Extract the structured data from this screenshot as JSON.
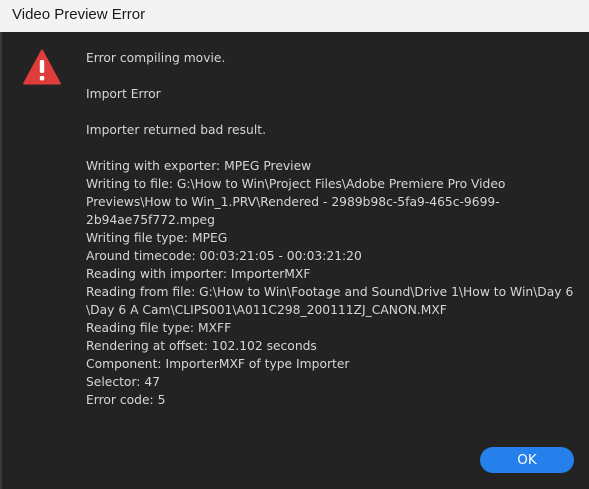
{
  "window": {
    "title": "Video Preview Error"
  },
  "icon": {
    "name": "warning-icon",
    "color": "#e03c3c"
  },
  "messages": {
    "primary": "Error compiling movie.",
    "secondary": "Import Error",
    "tertiary": "Importer returned bad result.",
    "details": [
      "Writing with exporter: MPEG Preview",
      "Writing to file: G:\\How to Win\\Project Files\\Adobe Premiere Pro Video",
      "Previews\\How to Win_1.PRV\\Rendered - 2989b98c-5fa9-465c-9699-",
      "2b94ae75f772.mpeg",
      "Writing file type: MPEG",
      "Around timecode: 00:03:21:05 - 00:03:21:20",
      "Reading with importer: ImporterMXF",
      "Reading from file: G:\\How to Win\\Footage and Sound\\Drive 1\\How to Win\\Day 6",
      "\\Day 6 A Cam\\CLIPS001\\A011C298_200111ZJ_CANON.MXF",
      "Reading file type: MXFF",
      "Rendering at offset: 102.102 seconds",
      "Component: ImporterMXF of type Importer",
      "Selector: 47",
      "Error code: 5"
    ]
  },
  "buttons": {
    "ok_label": "OK"
  },
  "colors": {
    "accent": "#2680eb",
    "background": "#232323",
    "text": "#d6d6d6",
    "titlebar": "#f3f3f3"
  }
}
